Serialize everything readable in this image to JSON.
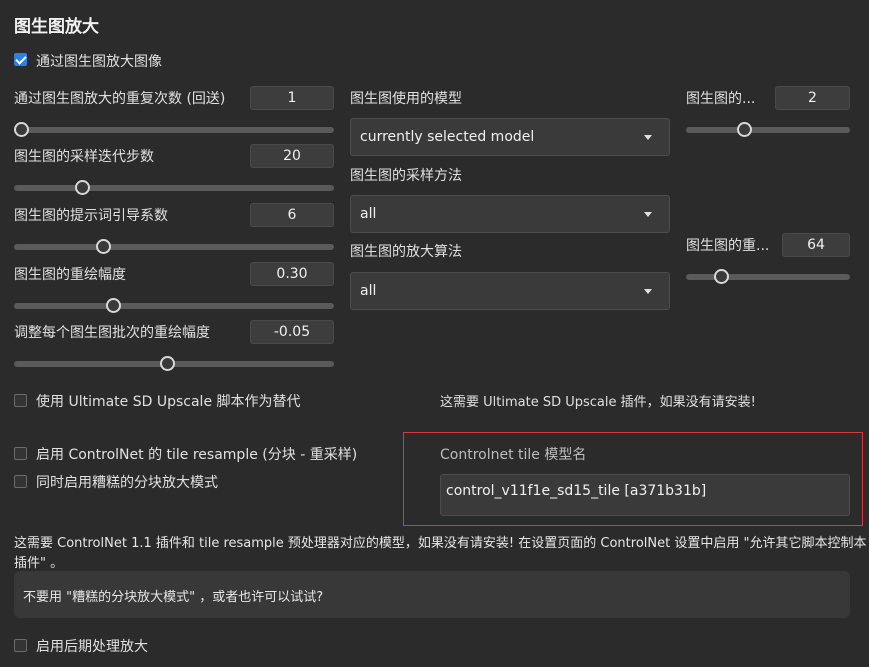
{
  "title": "图生图放大",
  "enable_upscale": {
    "label": "通过图生图放大图像",
    "checked": true
  },
  "left_params": [
    {
      "label": "通过图生图放大的重复次数 (回送)",
      "value": "1",
      "level": 0.0
    },
    {
      "label": "图生图的采样迭代步数",
      "value": "20",
      "level": 0.2
    },
    {
      "label": "图生图的提示词引导系数",
      "value": "6",
      "level": 0.27
    },
    {
      "label": "图生图的重绘幅度",
      "value": "0.30",
      "level": 0.3
    },
    {
      "label": "调整每个图生图批次的重绘幅度",
      "value": "-0.05",
      "level": 0.48
    }
  ],
  "middle_selects": [
    {
      "label": "图生图使用的模型",
      "value": "currently selected model"
    },
    {
      "label": "图生图的采样方法",
      "value": "all"
    },
    {
      "label": "图生图的放大算法",
      "value": "all"
    }
  ],
  "right_params": [
    {
      "label": "图生图的...",
      "value": "2",
      "level": 0.34
    },
    {
      "label": "图生图的重...",
      "value": "64",
      "level": 0.19
    }
  ],
  "ultimate": {
    "label": "使用 Ultimate SD Upscale 脚本作为替代",
    "checked": false,
    "note": "这需要 Ultimate SD Upscale 插件，如果没有请安装!"
  },
  "controlnet": {
    "tile_label": "启用 ControlNet 的 tile resample (分块 - 重采样)",
    "tile_checked": false,
    "rough_label": "同时启用糟糕的分块放大模式",
    "rough_checked": false,
    "model_label": "Controlnet tile 模型名",
    "model_value": "control_v11f1e_sd15_tile [a371b31b]",
    "note_line1": "这需要 ControlNet 1.1 插件和 tile resample 预处理器对应的模型，如果没有请安装! 在设置页面的 ControlNet 设置中启用 \"允许其它脚本控制本",
    "note_line2": "插件\" 。",
    "tip": "不要用 \"糟糕的分块放大模式\" ，或者也许可以试试?"
  },
  "postprocess": {
    "label": "启用后期处理放大",
    "checked": false
  }
}
